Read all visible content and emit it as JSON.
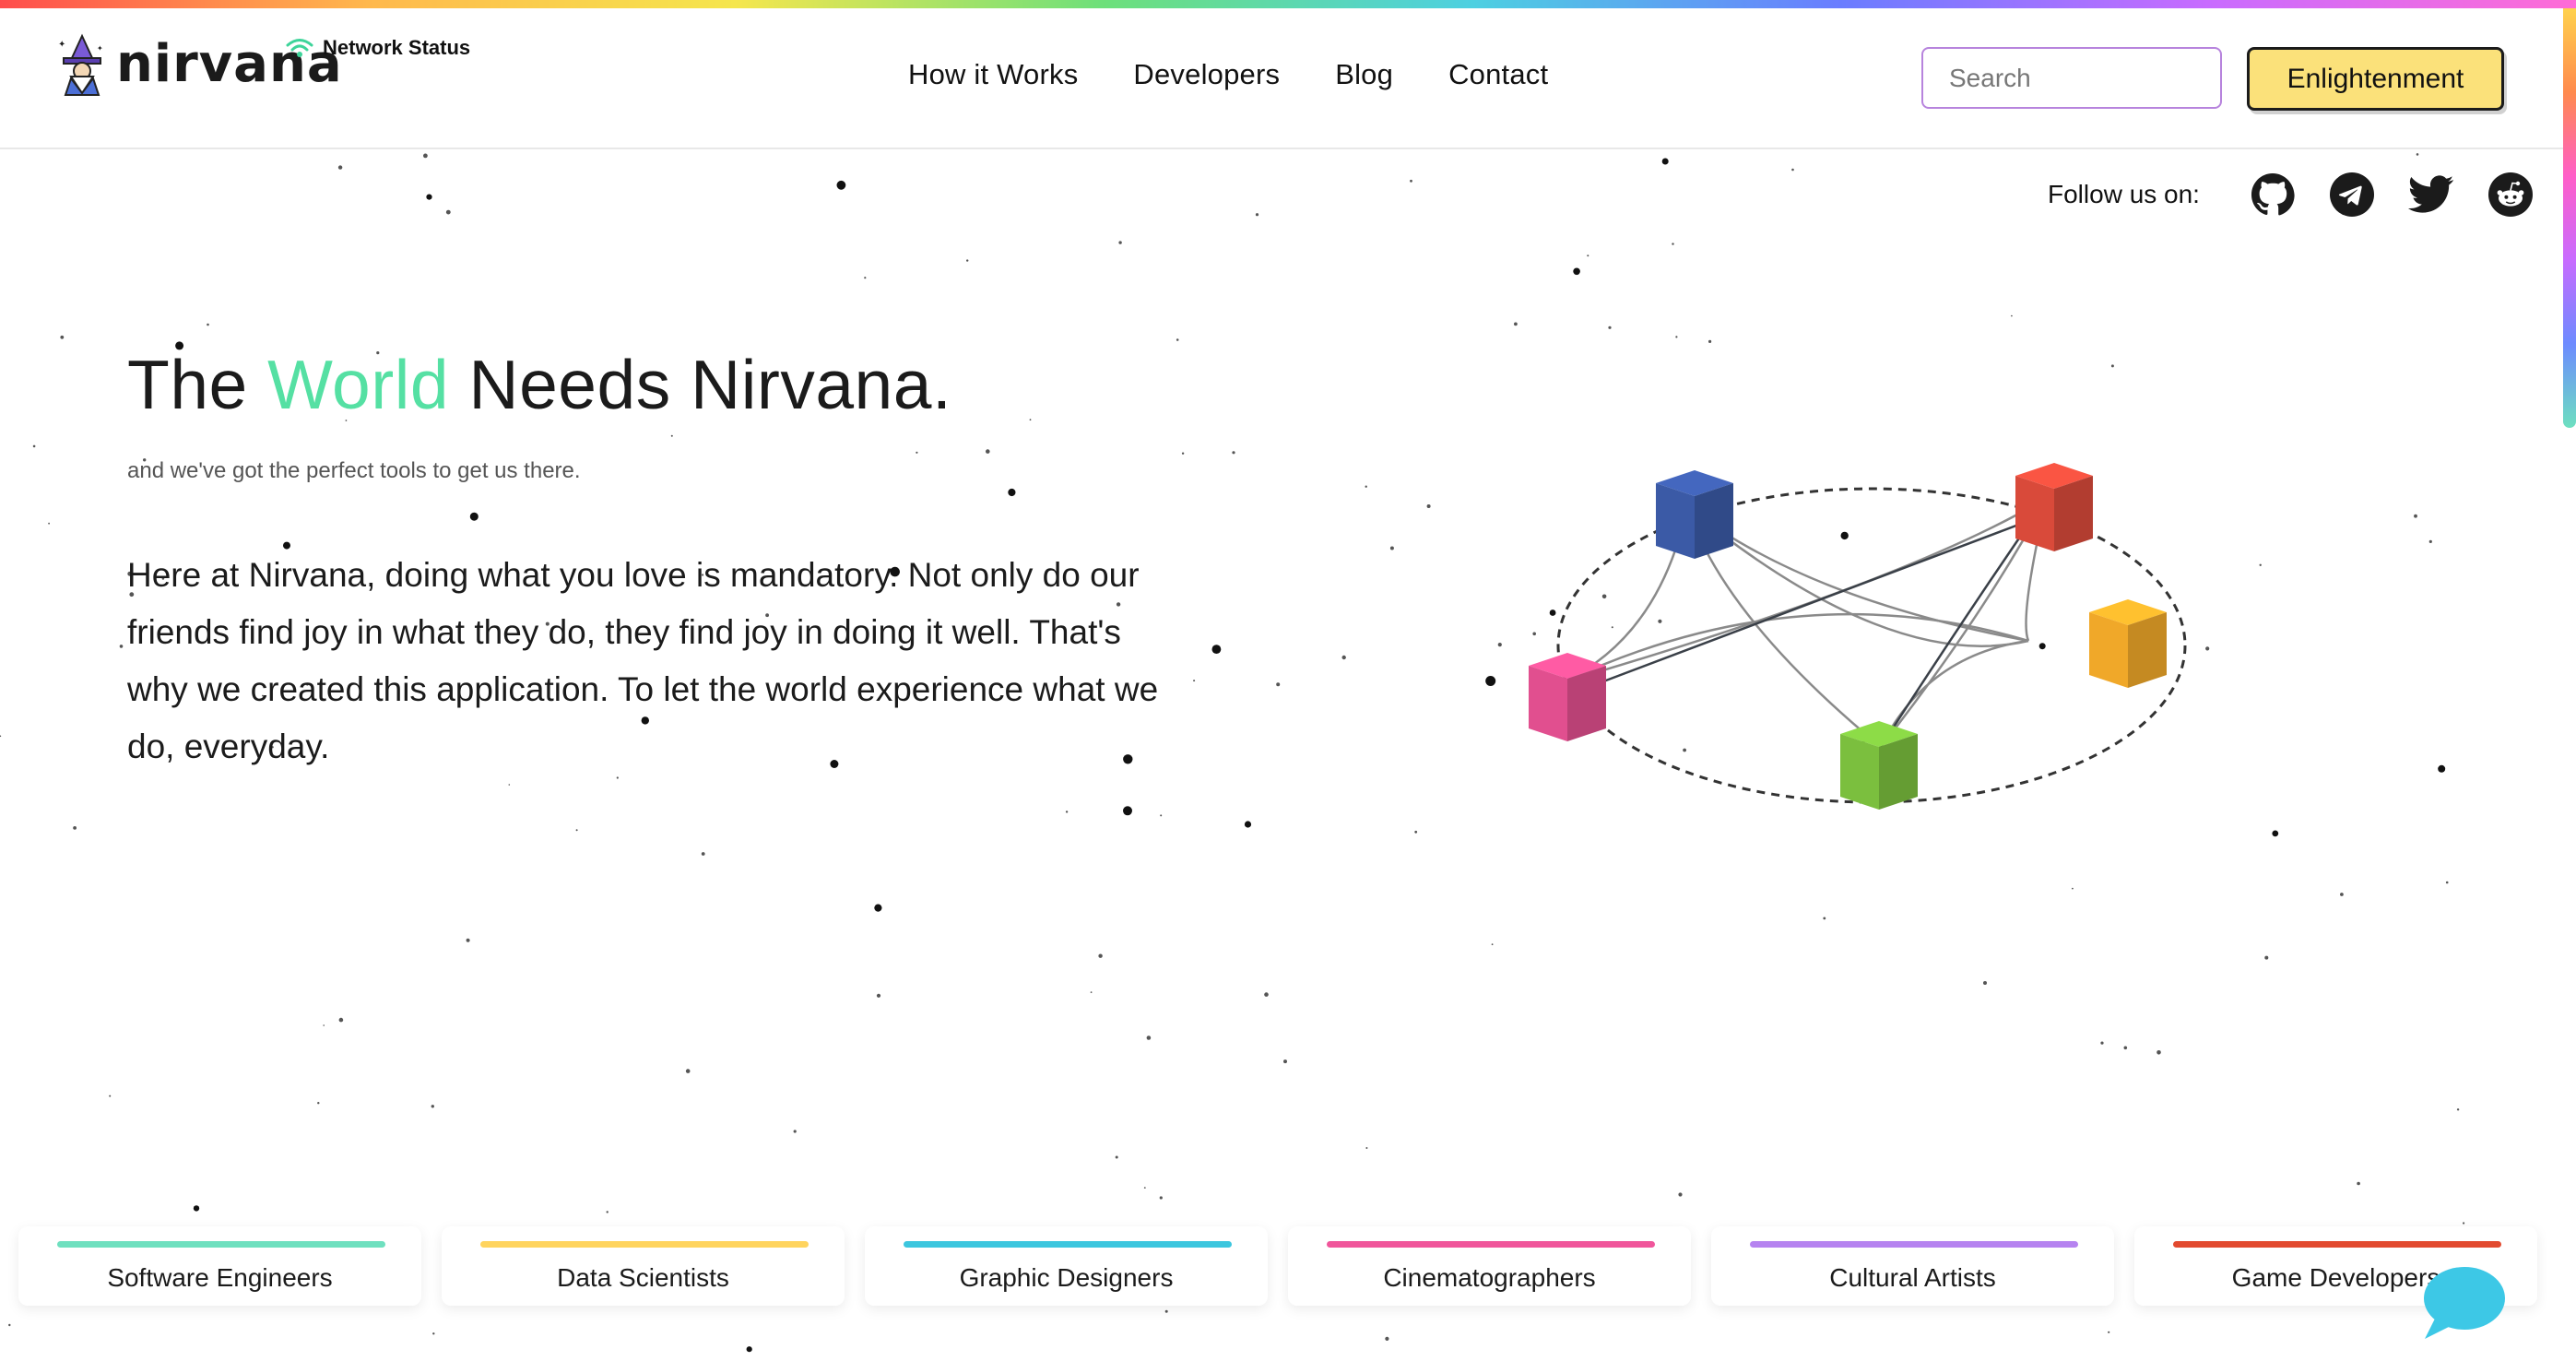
{
  "brand": {
    "name": "nirvana",
    "network_status": "Network Status"
  },
  "nav": [
    {
      "label": "How it Works"
    },
    {
      "label": "Developers"
    },
    {
      "label": "Blog"
    },
    {
      "label": "Contact"
    }
  ],
  "search": {
    "placeholder": "Search"
  },
  "cta": {
    "label": "Enlightenment"
  },
  "follow": {
    "label": "Follow us on:",
    "icons": [
      "github-icon",
      "telegram-icon",
      "twitter-icon",
      "reddit-icon"
    ]
  },
  "hero": {
    "title_before": "The ",
    "title_accent": "World",
    "title_after": " Needs Nirvana.",
    "tagline": "and we've got the perfect tools to get us there.",
    "body": "Here at Nirvana, doing what you love is mandatory. Not only do our friends find joy in what they do, they find joy in doing it well. That's why we created this application. To let the world experience what we do, everyday."
  },
  "network_nodes": [
    {
      "color": "#3b5aa6"
    },
    {
      "color": "#d94a3a"
    },
    {
      "color": "#f0a829"
    },
    {
      "color": "#7bbf3e"
    },
    {
      "color": "#e14f8f"
    }
  ],
  "categories": [
    {
      "label": "Software Engineers",
      "color": "#6fe0bf"
    },
    {
      "label": "Data Scientists",
      "color": "#ffd45e"
    },
    {
      "label": "Graphic Designers",
      "color": "#3cc6de"
    },
    {
      "label": "Cinematographers",
      "color": "#f0569b"
    },
    {
      "label": "Cultural Artists",
      "color": "#b683f0"
    },
    {
      "label": "Game Developers",
      "color": "#e24a2f"
    }
  ],
  "colors": {
    "accent": "#55e0a3",
    "button": "#fbe17a",
    "search_border": "#b784dd",
    "chat": "#3dc8e6"
  }
}
